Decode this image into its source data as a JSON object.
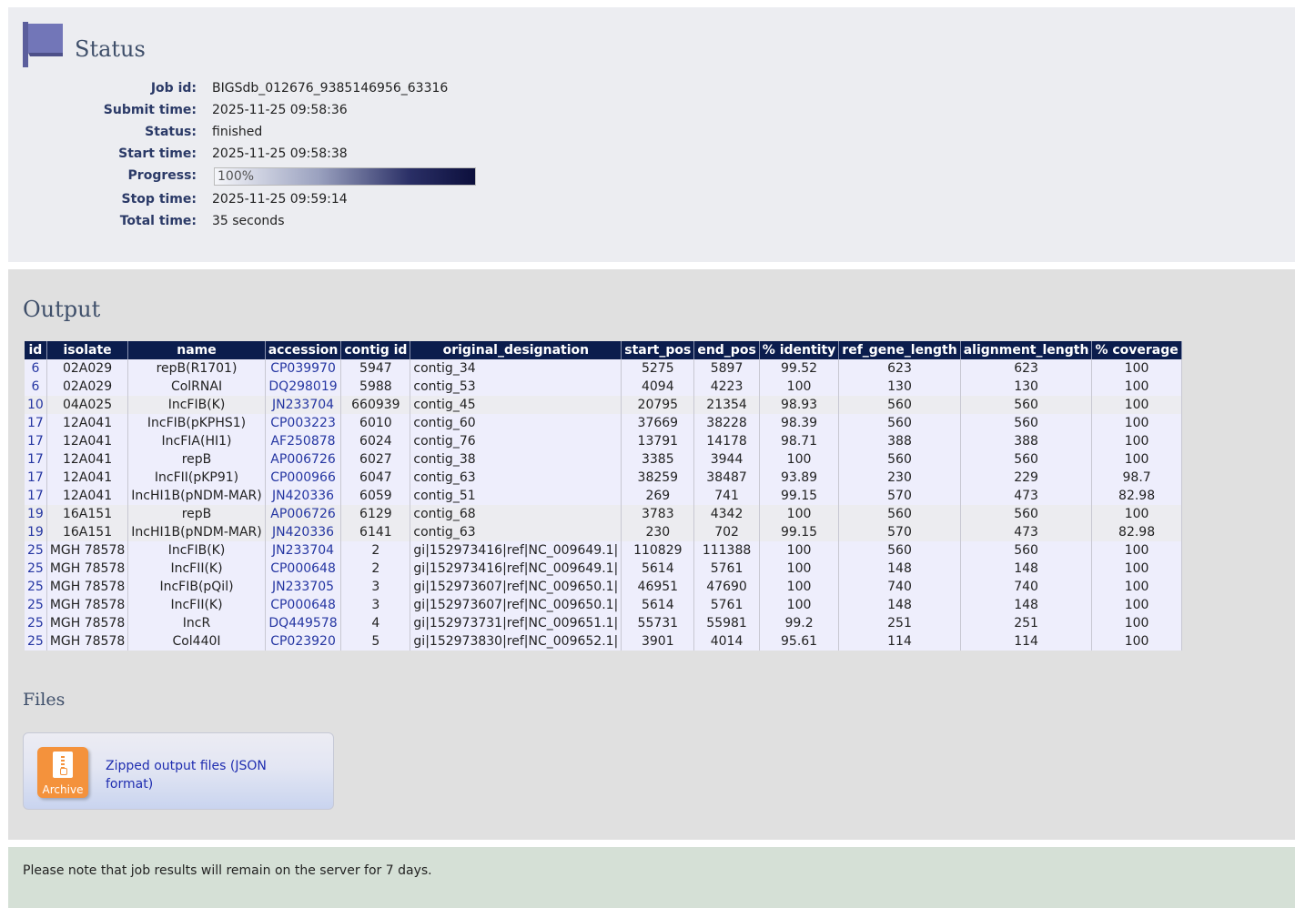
{
  "status": {
    "title": "Status",
    "fields": [
      {
        "label": "Job id:",
        "value": "BIGSdb_012676_9385146956_63316"
      },
      {
        "label": "Submit time:",
        "value": "2025-11-25 09:58:36"
      },
      {
        "label": "Status:",
        "value": "finished"
      },
      {
        "label": "Start time:",
        "value": "2025-11-25 09:58:38"
      },
      {
        "label": "Progress:",
        "value": "100%"
      },
      {
        "label": "Stop time:",
        "value": "2025-11-25 09:59:14"
      },
      {
        "label": "Total time:",
        "value": "35 seconds"
      }
    ],
    "progress_fraction": 1.0
  },
  "output": {
    "title": "Output",
    "columns": [
      "id",
      "isolate",
      "name",
      "accession",
      "contig id",
      "original_designation",
      "start_pos",
      "end_pos",
      "% identity",
      "ref_gene_length",
      "alignment_length",
      "% coverage"
    ],
    "rows": [
      [
        "6",
        "02A029",
        "repB(R1701)",
        "CP039970",
        "5947",
        "contig_34",
        "5275",
        "5897",
        "99.52",
        "623",
        "623",
        "100"
      ],
      [
        "6",
        "02A029",
        "ColRNAI",
        "DQ298019",
        "5988",
        "contig_53",
        "4094",
        "4223",
        "100",
        "130",
        "130",
        "100"
      ],
      [
        "10",
        "04A025",
        "IncFIB(K)",
        "JN233704",
        "660939",
        "contig_45",
        "20795",
        "21354",
        "98.93",
        "560",
        "560",
        "100"
      ],
      [
        "17",
        "12A041",
        "IncFIB(pKPHS1)",
        "CP003223",
        "6010",
        "contig_60",
        "37669",
        "38228",
        "98.39",
        "560",
        "560",
        "100"
      ],
      [
        "17",
        "12A041",
        "IncFIA(HI1)",
        "AF250878",
        "6024",
        "contig_76",
        "13791",
        "14178",
        "98.71",
        "388",
        "388",
        "100"
      ],
      [
        "17",
        "12A041",
        "repB",
        "AP006726",
        "6027",
        "contig_38",
        "3385",
        "3944",
        "100",
        "560",
        "560",
        "100"
      ],
      [
        "17",
        "12A041",
        "IncFII(pKP91)",
        "CP000966",
        "6047",
        "contig_63",
        "38259",
        "38487",
        "93.89",
        "230",
        "229",
        "98.7"
      ],
      [
        "17",
        "12A041",
        "IncHI1B(pNDM-MAR)",
        "JN420336",
        "6059",
        "contig_51",
        "269",
        "741",
        "99.15",
        "570",
        "473",
        "82.98"
      ],
      [
        "19",
        "16A151",
        "repB",
        "AP006726",
        "6129",
        "contig_68",
        "3783",
        "4342",
        "100",
        "560",
        "560",
        "100"
      ],
      [
        "19",
        "16A151",
        "IncHI1B(pNDM-MAR)",
        "JN420336",
        "6141",
        "contig_63",
        "230",
        "702",
        "99.15",
        "570",
        "473",
        "82.98"
      ],
      [
        "25",
        "MGH 78578",
        "IncFIB(K)",
        "JN233704",
        "2",
        "gi|152973416|ref|NC_009649.1|",
        "110829",
        "111388",
        "100",
        "560",
        "560",
        "100"
      ],
      [
        "25",
        "MGH 78578",
        "IncFII(K)",
        "CP000648",
        "2",
        "gi|152973416|ref|NC_009649.1|",
        "5614",
        "5761",
        "100",
        "148",
        "148",
        "100"
      ],
      [
        "25",
        "MGH 78578",
        "IncFIB(pQil)",
        "JN233705",
        "3",
        "gi|152973607|ref|NC_009650.1|",
        "46951",
        "47690",
        "100",
        "740",
        "740",
        "100"
      ],
      [
        "25",
        "MGH 78578",
        "IncFII(K)",
        "CP000648",
        "3",
        "gi|152973607|ref|NC_009650.1|",
        "5614",
        "5761",
        "100",
        "148",
        "148",
        "100"
      ],
      [
        "25",
        "MGH 78578",
        "IncR",
        "DQ449578",
        "4",
        "gi|152973731|ref|NC_009651.1|",
        "55731",
        "55981",
        "99.2",
        "251",
        "251",
        "100"
      ],
      [
        "25",
        "MGH 78578",
        "Col440I",
        "CP023920",
        "5",
        "gi|152973830|ref|NC_009652.1|",
        "3901",
        "4014",
        "95.61",
        "114",
        "114",
        "100"
      ]
    ],
    "row_shading": [
      "a",
      "a",
      "b",
      "a",
      "a",
      "a",
      "a",
      "a",
      "b",
      "b",
      "a",
      "a",
      "a",
      "a",
      "a",
      "a"
    ]
  },
  "files": {
    "title": "Files",
    "icon_caption": "Archive",
    "link_text": "Zipped output files (JSON format)"
  },
  "note": "Please note that job results will remain on the server for 7 days.",
  "colors": {
    "header_bg": "#0b1d4d",
    "link": "#2536a2",
    "label": "#2b3a67",
    "archive_icon": "#f4923c"
  }
}
